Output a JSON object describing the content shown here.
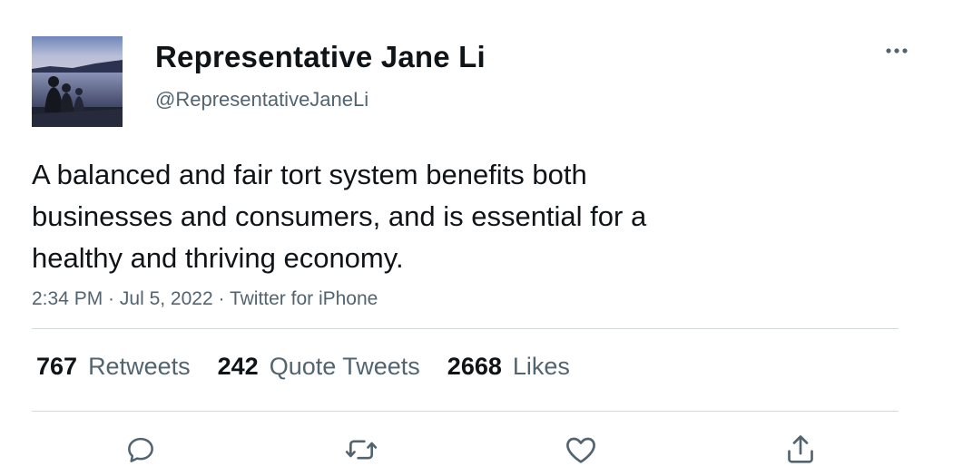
{
  "author": {
    "display_name": "Representative Jane Li",
    "handle": "@RepresentativeJaneLi",
    "avatar_icon": "profile-photo-lake-family"
  },
  "tweet": {
    "lines": [
      "A balanced and fair tort system benefits both",
      "businesses and consumers, and is essential for a",
      "healthy and thriving economy."
    ]
  },
  "meta": {
    "time": "2:34 PM",
    "separator": " · ",
    "date": "Jul 5, 2022",
    "source": "Twitter for iPhone"
  },
  "stats": {
    "retweets": {
      "count": "767",
      "label": "Retweets"
    },
    "quote_tweets": {
      "count": "242",
      "label": "Quote Tweets"
    },
    "likes": {
      "count": "2668",
      "label": "Likes"
    }
  },
  "actions": {
    "reply_icon": "reply-icon",
    "retweet_icon": "retweet-icon",
    "like_icon": "heart-icon",
    "share_icon": "share-icon",
    "more_icon": "more-options-icon"
  },
  "colors": {
    "text": "#0f1419",
    "secondary": "#536471",
    "divider": "#cfd9de"
  }
}
